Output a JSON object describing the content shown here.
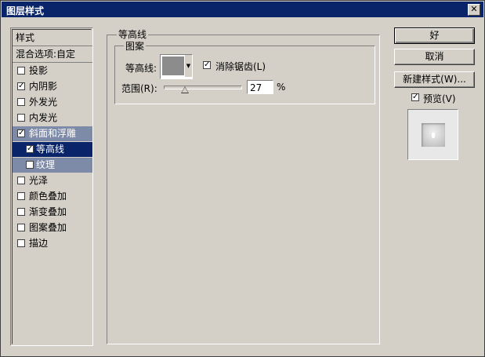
{
  "window": {
    "title": "图层样式",
    "close_glyph": "✕"
  },
  "left_panel": {
    "header": "样式",
    "blend": "混合选项:自定",
    "items": [
      {
        "label": "投影",
        "checked": false
      },
      {
        "label": "内阴影",
        "checked": true
      },
      {
        "label": "外发光",
        "checked": false
      },
      {
        "label": "内发光",
        "checked": false
      },
      {
        "label": "斜面和浮雕",
        "checked": true
      },
      {
        "label": "等高线",
        "checked": true
      },
      {
        "label": "纹理",
        "checked": false
      },
      {
        "label": "光泽",
        "checked": false
      },
      {
        "label": "颜色叠加",
        "checked": false
      },
      {
        "label": "渐变叠加",
        "checked": false
      },
      {
        "label": "图案叠加",
        "checked": false
      },
      {
        "label": "描边",
        "checked": false
      }
    ]
  },
  "contour": {
    "group_title": "等高线",
    "sub_title": "图案",
    "contour_label": "等高线:",
    "antialias_label": "消除锯齿(L)",
    "antialias_checked": true,
    "range_label": "范围(R):",
    "range_value": "27",
    "range_unit": "%",
    "range_fraction": 0.27
  },
  "buttons": {
    "ok": "好",
    "cancel": "取消",
    "new_style": "新建样式(W)...",
    "preview_label": "预览(V)",
    "preview_checked": true
  },
  "check_glyph": "✓",
  "dropdown_glyph": "▼"
}
